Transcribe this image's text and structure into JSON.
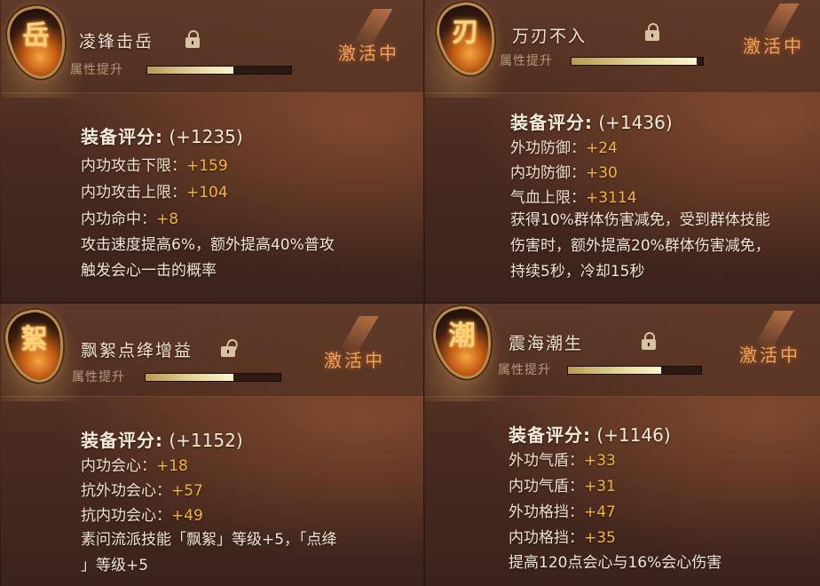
{
  "colors": {
    "stat_value": "#f3b33e",
    "status_active": "#f2a054",
    "bar_fill": "#e8da9a",
    "panel_bg": "#4a2b20"
  },
  "cards": [
    {
      "title": "凌锋击岳",
      "lock_icon": "lock-icon",
      "attr_label": "属性提升",
      "attr_progress": 0.6,
      "status": "激活中",
      "score_label": "装备评分:",
      "score_value": "(+1235)",
      "stats": [
        {
          "label": "内功攻击下限：",
          "value": "+159"
        },
        {
          "label": "内功攻击上限：",
          "value": "+104"
        },
        {
          "label": "内功命中：",
          "value": "+8"
        }
      ],
      "desc_lines": [
        "攻击速度提高6%，额外提高40%普攻",
        "触发会心一击的概率"
      ]
    },
    {
      "title": "万刃不入",
      "lock_icon": "lock-icon",
      "attr_label": "属性提升",
      "attr_progress": 0.95,
      "status": "激活中",
      "score_label": "装备评分:",
      "score_value": "(+1436)",
      "stats": [
        {
          "label": "外功防御：",
          "value": "+24"
        },
        {
          "label": "内功防御：",
          "value": "+30"
        },
        {
          "label": "气血上限：",
          "value": "+3114"
        }
      ],
      "desc_lines": [
        "获得10%群体伤害减免，受到群体技能",
        "伤害时，额外提高20%群体伤害减免，",
        "持续5秒，冷却15秒"
      ]
    },
    {
      "title": "飘絮点绛增益",
      "lock_icon": "unlock-icon",
      "attr_label": "属性提升",
      "attr_progress": 0.65,
      "status": "激活中",
      "score_label": "装备评分:",
      "score_value": "(+1152)",
      "stats": [
        {
          "label": "内功会心：",
          "value": "+18"
        },
        {
          "label": "抗外功会心：",
          "value": "+57"
        },
        {
          "label": "抗内功会心：",
          "value": "+49"
        }
      ],
      "desc_lines": [
        "素问流派技能「飘絮」等级+5，「点绛",
        "」等级+5"
      ]
    },
    {
      "title": "震海潮生",
      "lock_icon": "lock-icon",
      "attr_label": "属性提升",
      "attr_progress": 0.7,
      "status": "激活中",
      "score_label": "装备评分:",
      "score_value": "(+1146)",
      "stats": [
        {
          "label": "外功气盾：",
          "value": "+33"
        },
        {
          "label": "内功气盾：",
          "value": "+31"
        },
        {
          "label": "外功格挡：",
          "value": "+47"
        },
        {
          "label": "内功格挡：",
          "value": "+35"
        }
      ],
      "desc_lines": [
        "提高120点会心与16%会心伤害"
      ]
    }
  ]
}
